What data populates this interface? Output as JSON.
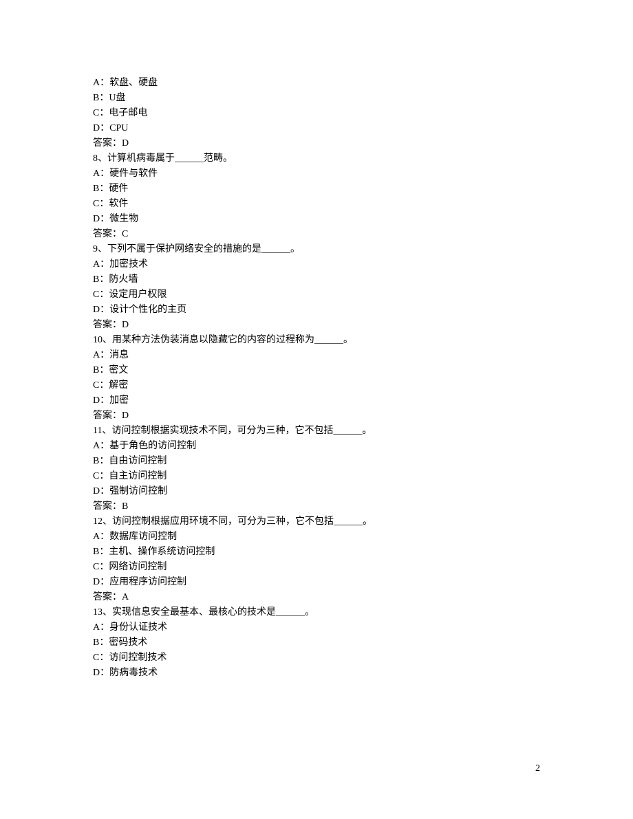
{
  "page_number": "2",
  "lines": {
    "l1": "A：软盘、硬盘",
    "l2": "B：U盘",
    "l3": "C：电子邮电",
    "l4": "D：CPU",
    "l5": "答案：D",
    "l6": "",
    "l7": "8、计算机病毒属于______范畴。",
    "l8": "A：硬件与软件",
    "l9": "B：硬件",
    "l10": "C：软件",
    "l11": "D：微生物",
    "l12": "答案：C",
    "l13": "",
    "l14": "9、下列不属于保护网络安全的措施的是______。",
    "l15": "A：加密技术",
    "l16": "B：防火墙",
    "l17": "C：设定用户权限",
    "l18": "D：设计个性化的主页",
    "l19": "答案：D",
    "l20": "",
    "l21": "10、用某种方法伪装消息以隐藏它的内容的过程称为______。",
    "l22": "A：消息",
    "l23": "B：密文",
    "l24": "C：解密",
    "l25": "D：加密",
    "l26": "答案：D",
    "l27": "",
    "l28": "",
    "l29": "11、访问控制根据实现技术不同，可分为三种，它不包括______。",
    "l30": "A：基于角色的访问控制",
    "l31": "B：自由访问控制",
    "l32": "C：自主访问控制",
    "l33": "D：强制访问控制",
    "l34": "答案：B",
    "l35": "",
    "l36": "12、访问控制根据应用环境不同，可分为三种，它不包括______。",
    "l37": "A：数据库访问控制",
    "l38": "B：主机、操作系统访问控制",
    "l39": "C：网络访问控制",
    "l40": "D：应用程序访问控制",
    "l41": "答案：A",
    "l42": "",
    "l43": "13、实现信息安全最基本、最核心的技术是______。",
    "l44": "A：身份认证技术",
    "l45": "B：密码技术",
    "l46": "C：访问控制技术",
    "l47": "D：防病毒技术"
  }
}
